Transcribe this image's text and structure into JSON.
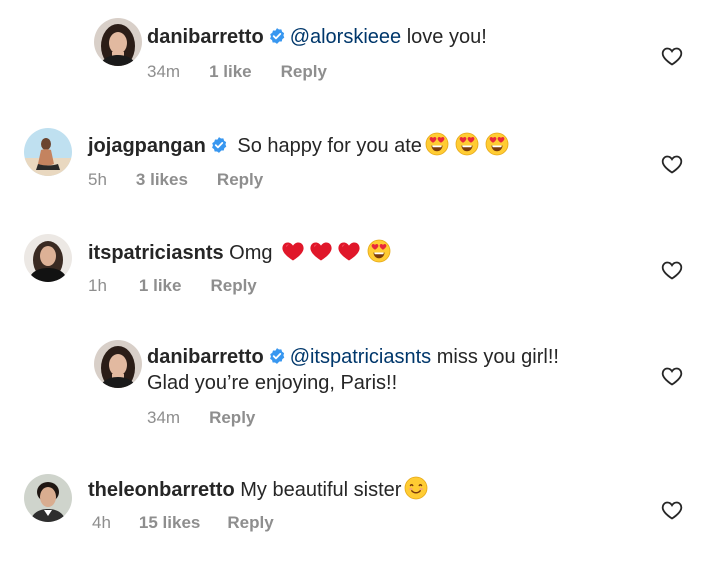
{
  "comments": [
    {
      "username": "danibarretto",
      "verified": true,
      "mention": "@alorskieee",
      "text": " love you!",
      "time": "34m",
      "likes": "1 like",
      "reply": "Reply",
      "avatar": "avatar-dani"
    },
    {
      "username": "jojagpangan",
      "verified": true,
      "text": " So happy for you ate",
      "emojis": [
        "heart-eyes-emoji",
        "heart-eyes-emoji",
        "heart-eyes-emoji"
      ],
      "time": "5h",
      "likes": "3 likes",
      "reply": "Reply",
      "avatar": "avatar-joja"
    },
    {
      "username": "itspatriciasnts",
      "verified": false,
      "text": " Omg ",
      "emojis": [
        "red-heart-emoji",
        "red-heart-emoji",
        "red-heart-emoji",
        "heart-eyes-emoji"
      ],
      "time": "1h",
      "likes": "1 like",
      "reply": "Reply",
      "avatar": "avatar-patricia"
    },
    {
      "username": "danibarretto",
      "verified": true,
      "mention": "@itspatriciasnts",
      "text": " miss you girl!!",
      "text2": "Glad you’re enjoying, Paris!!",
      "time": "34m",
      "reply": "Reply",
      "avatar": "avatar-dani"
    },
    {
      "username": "theleonbarretto",
      "verified": false,
      "text": " My beautiful sister",
      "emojis": [
        "smiling-emoji"
      ],
      "time": "4h",
      "likes": "15 likes",
      "reply": "Reply",
      "avatar": "avatar-leon"
    }
  ],
  "colors": {
    "text": "#262626",
    "meta": "#8e8e8e",
    "mention": "#00376b",
    "verified": "#3897f0"
  }
}
